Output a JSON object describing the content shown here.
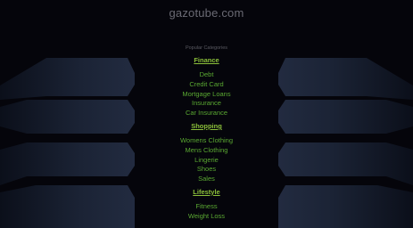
{
  "site": {
    "title": "gazotube.com"
  },
  "panel": {
    "heading": "Popular Categories",
    "categories": [
      {
        "title": "Finance",
        "items": [
          "Debt",
          "Credit Card",
          "Mortgage Loans",
          "Insurance",
          "Car Insurance"
        ]
      },
      {
        "title": "Shopping",
        "items": [
          "Womens Clothing",
          "Mens Clothing",
          "Lingerie",
          "Shoes",
          "Sales"
        ]
      },
      {
        "title": "Lifestyle",
        "items": [
          "Fitness",
          "Weight Loss"
        ]
      }
    ]
  },
  "colors": {
    "background": "#05050b",
    "category_title": "#8bbf3a",
    "category_link": "#5aa832",
    "site_title": "#6a6a74",
    "decor_shape": "#1c2436"
  }
}
